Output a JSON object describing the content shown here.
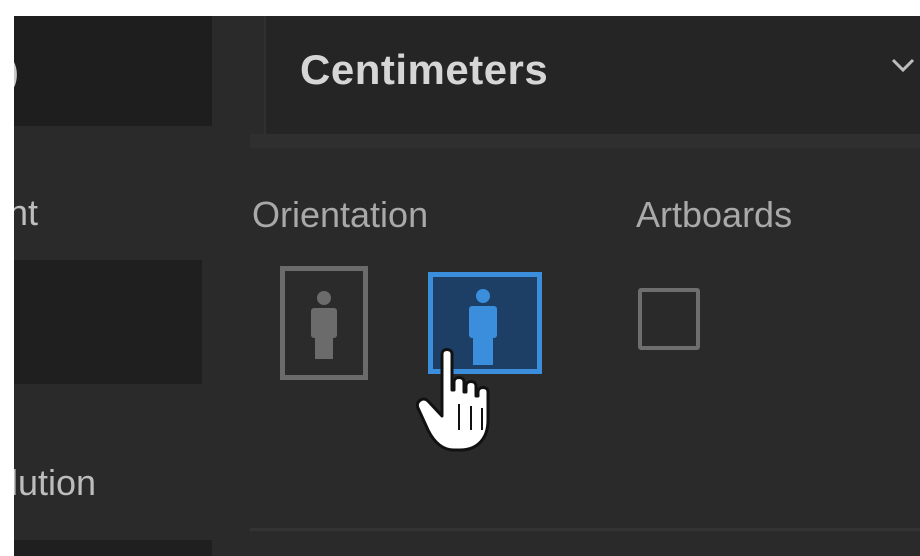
{
  "units": {
    "selected": "Centimeters"
  },
  "fields": {
    "height_label_fragment": "ht",
    "resolution_label_fragment": "lution"
  },
  "orientation": {
    "label": "Orientation",
    "selected": "landscape",
    "options": [
      {
        "name": "portrait",
        "icon": "portrait-person-icon"
      },
      {
        "name": "landscape",
        "icon": "landscape-person-icon"
      }
    ]
  },
  "artboards": {
    "label": "Artboards",
    "checked": false
  },
  "colors": {
    "panel_bg": "#2a2a2a",
    "field_bg": "#1f1f1f",
    "accent": "#3b8edb",
    "text": "#bdbdbd"
  },
  "cursor": {
    "icon": "hand-pointer-icon"
  }
}
